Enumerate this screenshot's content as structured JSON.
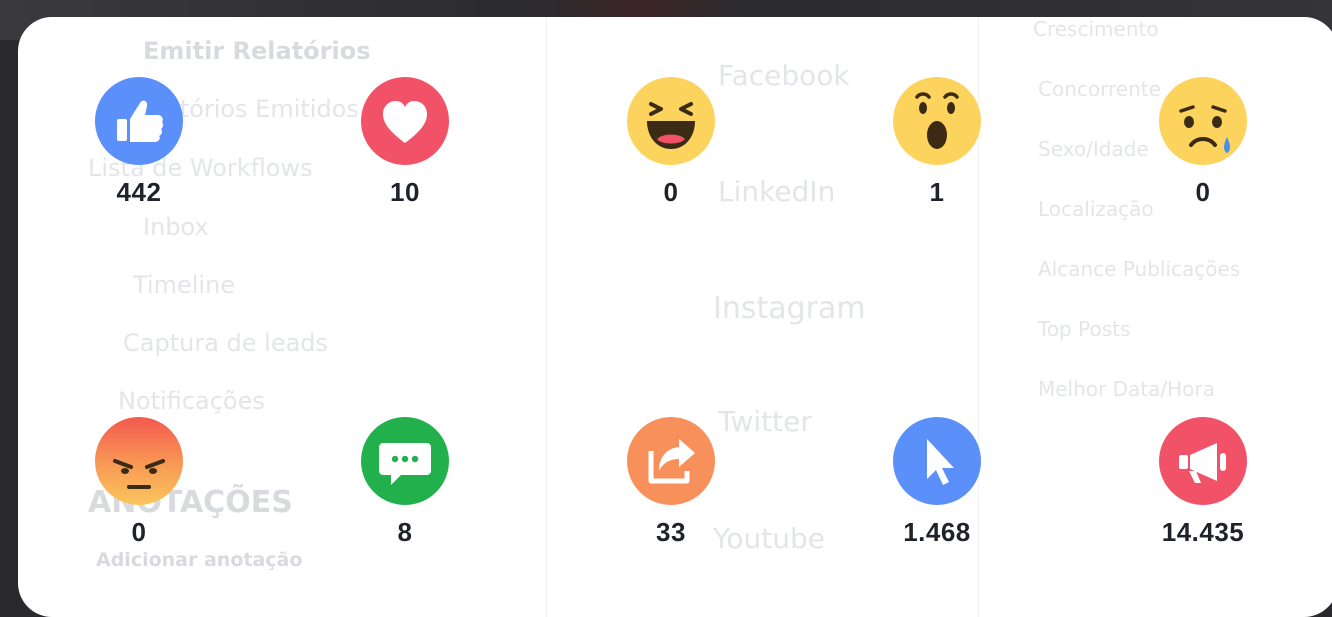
{
  "background": {
    "menu": [
      "Emitir Relatórios",
      "Relatórios Emitidos",
      "Lista de Workflows",
      "Inbox",
      "Timeline",
      "Captura de leads",
      "Notificações"
    ],
    "section_title": "ANOTAÇÕES",
    "add_note": "Adicionar anotação",
    "networks": [
      "Facebook",
      "LinkedIn",
      "Instagram",
      "Twitter",
      "Youtube"
    ],
    "checks": [
      "Crescimento",
      "Concorrente",
      "Sexo/Idade",
      "Localização",
      "Alcance Publicações",
      "Top Posts",
      "Melhor Data/Hora"
    ]
  },
  "metrics": [
    {
      "name": "like-icon",
      "count": "442",
      "color": "#5b8ff9"
    },
    {
      "name": "love-icon",
      "count": "10",
      "color": "#f25268"
    },
    {
      "name": "haha-icon",
      "count": "0",
      "color": "#fcd35c"
    },
    {
      "name": "wow-icon",
      "count": "1",
      "color": "#fcd35c"
    },
    {
      "name": "sad-icon",
      "count": "0",
      "color": "#fcd35c"
    },
    {
      "name": "angry-icon",
      "count": "0",
      "color": "#f6763e"
    },
    {
      "name": "comments-icon",
      "count": "8",
      "color": "#21b04b"
    },
    {
      "name": "shares-icon",
      "count": "33",
      "color": "#f7905a"
    },
    {
      "name": "clicks-icon",
      "count": "1.468",
      "color": "#5b8ff9"
    },
    {
      "name": "reach-icon",
      "count": "14.435",
      "color": "#f25268"
    }
  ]
}
